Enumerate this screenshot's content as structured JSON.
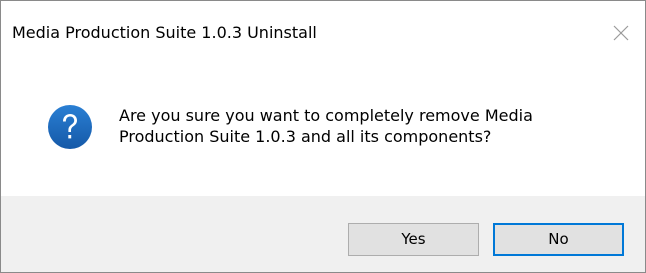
{
  "window": {
    "title": "Media Production Suite 1.0.3 Uninstall"
  },
  "dialog": {
    "icon": "question-icon",
    "message_line1": "Are you sure you want to completely remove Media",
    "message_line2": "Production Suite 1.0.3 and all its components?"
  },
  "buttons": {
    "yes_label": "Yes",
    "no_label": "No",
    "default": "No"
  },
  "colors": {
    "icon_blue": "#1e6bbf",
    "focus_border": "#0078d7",
    "footer_bg": "#f0f0f0",
    "button_bg": "#e1e1e1"
  }
}
